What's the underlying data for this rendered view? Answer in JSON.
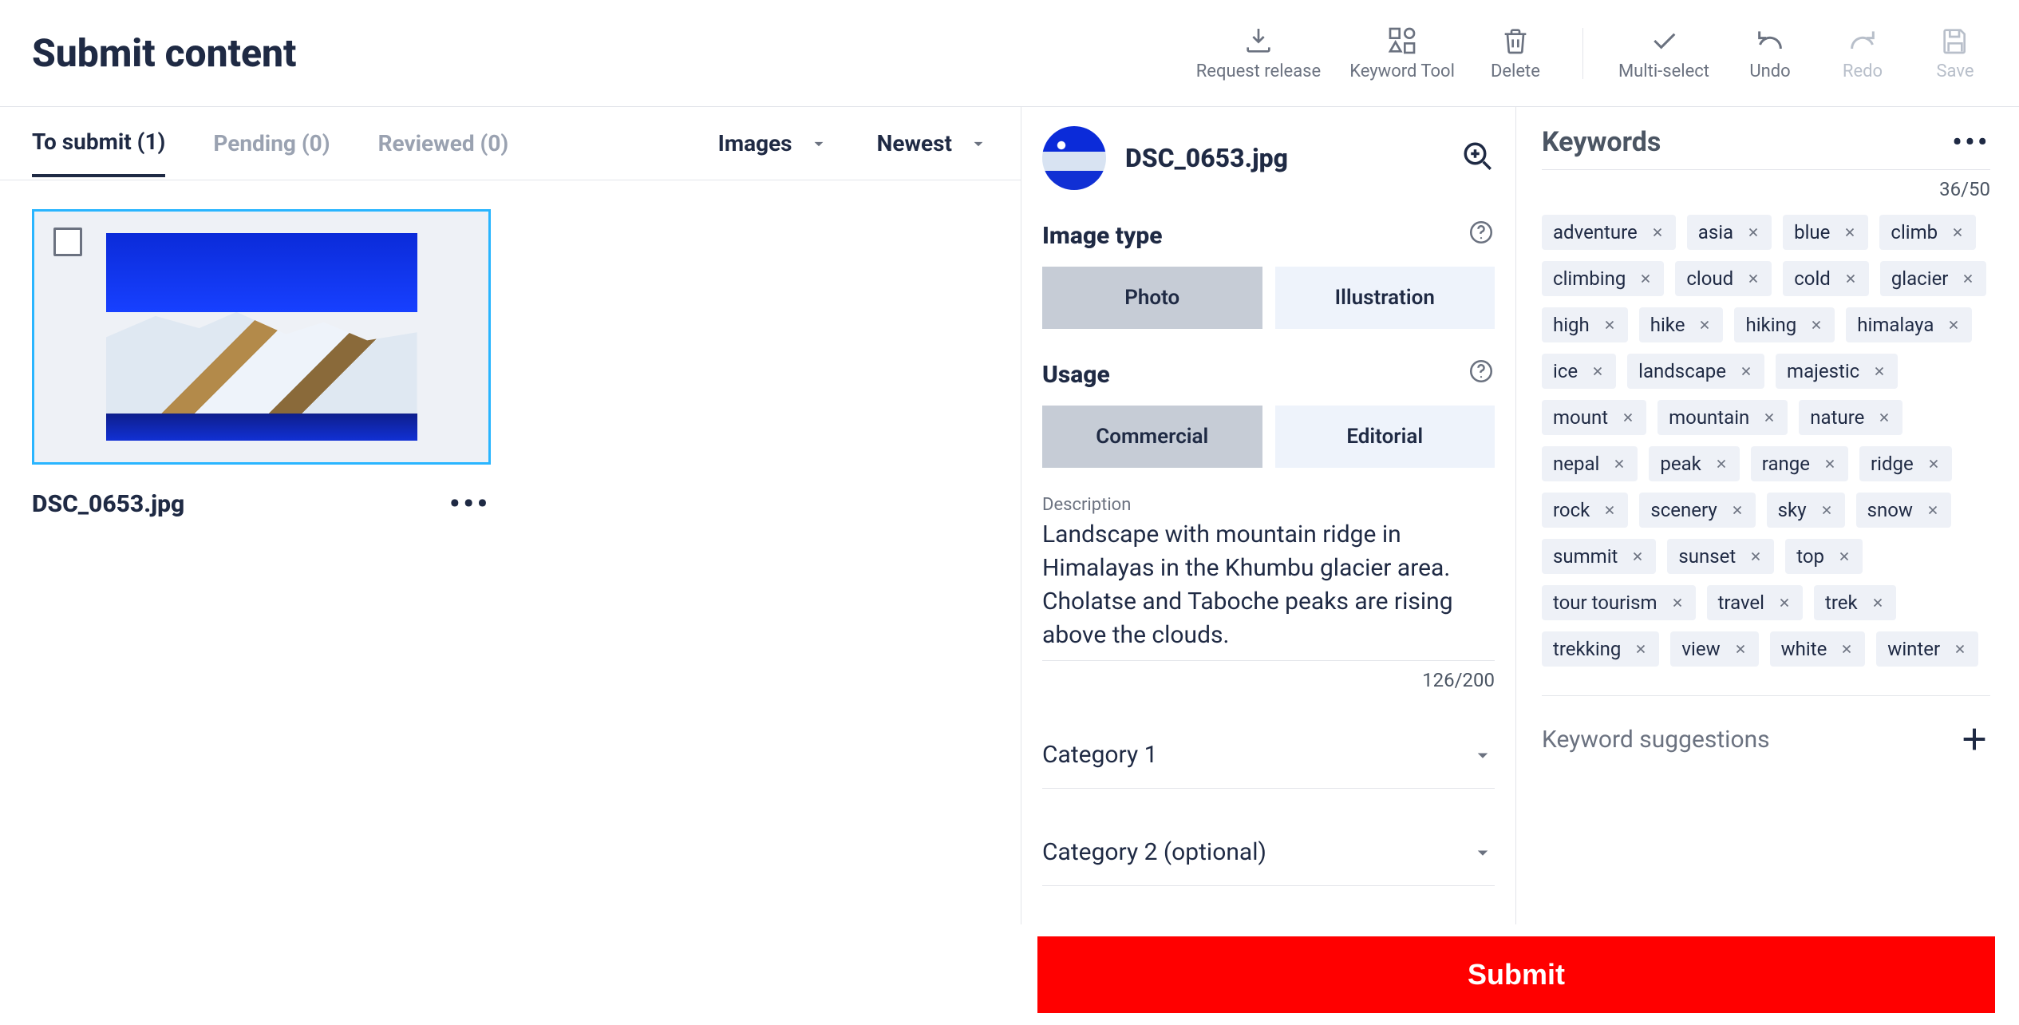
{
  "header": {
    "title": "Submit content"
  },
  "toolbar": {
    "request_release": "Request release",
    "keyword_tool": "Keyword Tool",
    "delete": "Delete",
    "multi_select": "Multi-select",
    "undo": "Undo",
    "redo": "Redo",
    "save": "Save"
  },
  "tabs": {
    "to_submit": "To submit (1)",
    "pending": "Pending (0)",
    "reviewed": "Reviewed (0)"
  },
  "filters": {
    "type": "Images",
    "sort": "Newest"
  },
  "thumb": {
    "filename": "DSC_0653.jpg"
  },
  "detail": {
    "filename": "DSC_0653.jpg",
    "image_type_label": "Image type",
    "photo": "Photo",
    "illustration": "Illustration",
    "usage_label": "Usage",
    "commercial": "Commercial",
    "editorial": "Editorial",
    "description_label": "Description",
    "description": "Landscape with mountain ridge in Himalayas in the Khumbu glacier area. Cholatse and Taboche peaks are rising above the clouds.",
    "description_counter": "126/200",
    "category1": "Category 1",
    "category2": "Category 2 (optional)"
  },
  "keywords": {
    "heading": "Keywords",
    "counter": "36/50",
    "suggestions": "Keyword suggestions",
    "items": [
      "adventure",
      "asia",
      "blue",
      "climb",
      "climbing",
      "cloud",
      "cold",
      "glacier",
      "high",
      "hike",
      "hiking",
      "himalaya",
      "ice",
      "landscape",
      "majestic",
      "mount",
      "mountain",
      "nature",
      "nepal",
      "peak",
      "range",
      "ridge",
      "rock",
      "scenery",
      "sky",
      "snow",
      "summit",
      "sunset",
      "top",
      "tour tourism",
      "travel",
      "trek",
      "trekking",
      "view",
      "white",
      "winter"
    ]
  },
  "submit": {
    "label": "Submit"
  }
}
